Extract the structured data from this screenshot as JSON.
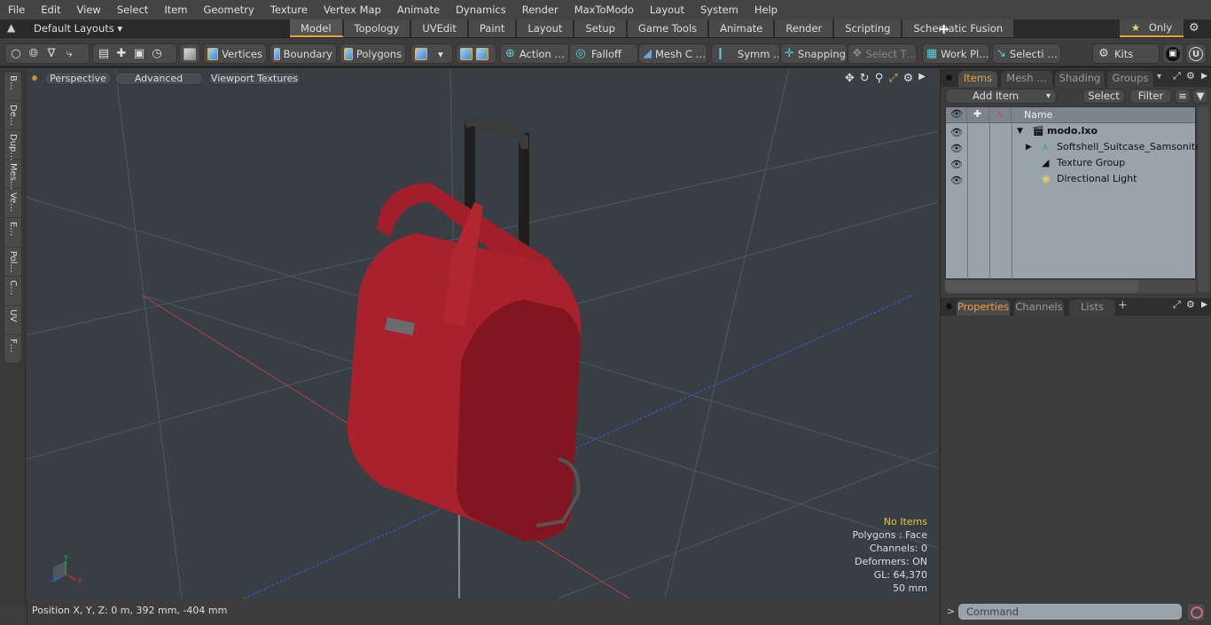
{
  "menu": [
    "File",
    "Edit",
    "View",
    "Select",
    "Item",
    "Geometry",
    "Texture",
    "Vertex Map",
    "Animate",
    "Dynamics",
    "Render",
    "MaxToModo",
    "Layout",
    "System",
    "Help"
  ],
  "layout": {
    "default_layouts": "Default Layouts ▾",
    "tabs": [
      "Model",
      "Topology",
      "UVEdit",
      "Paint",
      "Layout",
      "Setup",
      "Game Tools",
      "Animate",
      "Render",
      "Scripting",
      "Schematic Fusion"
    ],
    "active_tab": "Model",
    "add_tab": "+",
    "only_label": "Only",
    "star": "★"
  },
  "toolbar": {
    "vertices": "Vertices",
    "boundary": "Boundary",
    "polygons": "Polygons",
    "action": "Action …",
    "falloff": "Falloff",
    "mesh": "Mesh C …",
    "symmetry": "Symm …",
    "snapping": "Snapping",
    "select_t": "Select T…",
    "workplane": "Work Pl…",
    "selection": "Selecti …",
    "kits": "Kits"
  },
  "left_tabs": [
    "B…",
    "De…",
    "Dup…",
    "Mes…",
    "Ve…",
    "E…",
    "Pol…",
    "C…",
    "UV",
    "F…"
  ],
  "viewport": {
    "perspective": "Perspective",
    "advanced": "Advanced",
    "textures": "Viewport Textures",
    "info": {
      "items": "No Items",
      "polygons": "Polygons : Face",
      "channels": "Channels: 0",
      "deformers": "Deformers: ON",
      "gl": "GL: 64,370",
      "scale": "50 mm"
    },
    "colors": {
      "bg": "#383f44",
      "suitcase": "#a8202c",
      "x_axis": "#c0392b",
      "z_axis": "#3a4fd0"
    }
  },
  "status": {
    "position": "Position X, Y, Z:   0 m, 392 mm, -404 mm"
  },
  "items_panel": {
    "tabs": [
      "Items",
      "Mesh …",
      "Shading",
      "Groups"
    ],
    "active_tab": "Items",
    "add_item": "Add Item",
    "select": "Select",
    "filter": "Filter",
    "column_name": "Name",
    "rows": [
      {
        "name": "modo.lxo",
        "bold": true
      },
      {
        "name": "Softshell_Suitcase_Samsonite…"
      },
      {
        "name": "Texture Group"
      },
      {
        "name": "Directional Light"
      }
    ]
  },
  "properties_panel": {
    "tabs": [
      "Properties",
      "Channels",
      "Lists"
    ],
    "active_tab": "Properties",
    "add": "+"
  },
  "command": {
    "prompt": ">",
    "placeholder": "Command"
  }
}
